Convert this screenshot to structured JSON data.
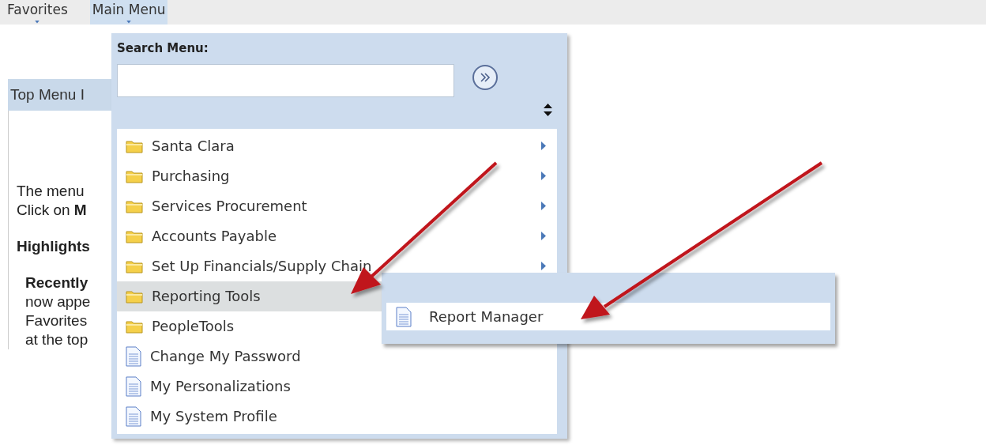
{
  "top_bar": {
    "items": [
      {
        "label": "Favorites",
        "selected": false
      },
      {
        "label": "Main Menu",
        "selected": true
      }
    ]
  },
  "page": {
    "header": "Top Menu I",
    "lines": [
      {
        "text": "The menu",
        "kind": "plain"
      },
      {
        "text": "Click on **M**",
        "kind": "plain"
      },
      {
        "text": "Highlights",
        "kind": "heading"
      },
      {
        "text": "Recently",
        "kind": "subheading"
      },
      {
        "text": "now appe",
        "kind": "indented"
      },
      {
        "text": "Favorites",
        "kind": "indented"
      },
      {
        "text": "at the top",
        "kind": "indented"
      }
    ]
  },
  "menu": {
    "search_label": "Search Menu:",
    "items": [
      {
        "label": "Santa Clara",
        "kind": "folder",
        "has_submenu": true,
        "selected": false
      },
      {
        "label": "Purchasing",
        "kind": "folder",
        "has_submenu": true,
        "selected": false
      },
      {
        "label": "Services Procurement",
        "kind": "folder",
        "has_submenu": true,
        "selected": false
      },
      {
        "label": "Accounts Payable",
        "kind": "folder",
        "has_submenu": true,
        "selected": false
      },
      {
        "label": "Set Up Financials/Supply Chain",
        "kind": "folder",
        "has_submenu": true,
        "selected": false
      },
      {
        "label": "Reporting Tools",
        "kind": "folder",
        "selected": true
      },
      {
        "label": "PeopleTools",
        "kind": "folder",
        "selected": false
      },
      {
        "label": "Change My Password",
        "kind": "page",
        "has_submenu": false,
        "selected": false
      },
      {
        "label": "My Personalizations",
        "kind": "page",
        "has_submenu": false,
        "selected": false
      },
      {
        "label": "My System Profile",
        "kind": "page",
        "has_submenu": false,
        "selected": false
      }
    ]
  },
  "submenu": {
    "items": [
      {
        "label": "Report Manager",
        "kind": "page"
      }
    ]
  }
}
